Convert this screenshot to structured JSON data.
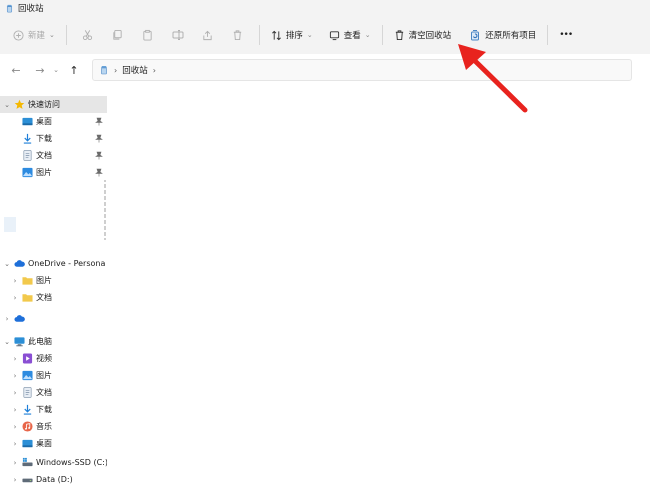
{
  "window": {
    "title": "回收站"
  },
  "toolbar": {
    "new_label": "新建",
    "sort_label": "排序",
    "view_label": "查看",
    "empty_recycle_bin_label": "清空回收站",
    "restore_all_label": "还原所有项目",
    "more_label": "•••"
  },
  "address": {
    "crumb": "回收站"
  },
  "sidebar": {
    "quick_access": "快速访问",
    "quick_items": [
      "桌面",
      "下载",
      "文档",
      "图片"
    ],
    "onedrive": "OneDrive - Persona",
    "onedrive_items": [
      "图片",
      "文档"
    ],
    "this_pc": "此电脑",
    "pc_items": [
      "视频",
      "图片",
      "文档",
      "下载",
      "音乐",
      "桌面",
      "Windows-SSD (C:)",
      "Data (D:)"
    ]
  },
  "colors": {
    "accent_arrow": "#e8231e",
    "folder": "#f2c94c",
    "onedrive_blue": "#1e6fd9"
  }
}
